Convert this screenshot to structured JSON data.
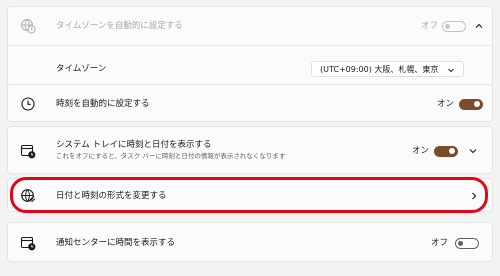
{
  "settings": {
    "auto_timezone": {
      "label": "タイムゾーンを自動的に設定する",
      "state": "オフ",
      "value": false,
      "disabled": true
    },
    "timezone": {
      "label": "タイムゾーン",
      "selected": "(UTC+09:00) 大阪、札幌、東京"
    },
    "auto_time": {
      "label": "時刻を自動的に設定する",
      "state": "オン",
      "value": true
    },
    "systray_time": {
      "label": "システム トレイに時刻と日付を表示する",
      "sublabel": "これをオフにすると、タスク バーに時刻と日付の情報が表示されなくなります",
      "state": "オン",
      "value": true
    },
    "change_format": {
      "label": "日付と時刻の形式を変更する"
    },
    "notification_center_time": {
      "label": "通知センターに時間を表示する",
      "state": "オフ",
      "value": false
    }
  },
  "colors": {
    "accent": "#7b4b2a",
    "highlight": "#e30613"
  },
  "icons": {
    "auto_timezone": "globe-clock-icon",
    "auto_time": "clock-icon",
    "systray_time": "calendar-clock-icon",
    "change_format": "globe-icon",
    "notification_center_time": "calendar-clock-icon"
  }
}
